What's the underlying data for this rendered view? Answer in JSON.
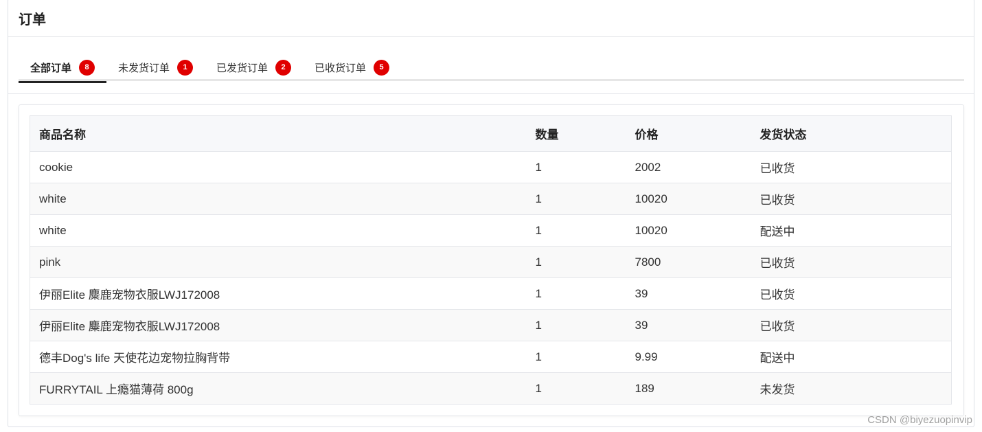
{
  "header": {
    "title": "订单"
  },
  "tabs": [
    {
      "label": "全部订单",
      "count": "8",
      "active": true
    },
    {
      "label": "未发货订单",
      "count": "1",
      "active": false
    },
    {
      "label": "已发货订单",
      "count": "2",
      "active": false
    },
    {
      "label": "已收货订单",
      "count": "5",
      "active": false
    }
  ],
  "table": {
    "columns": [
      "商品名称",
      "数量",
      "价格",
      "发货状态"
    ],
    "rows": [
      [
        "cookie",
        "1",
        "2002",
        "已收货"
      ],
      [
        "white",
        "1",
        "10020",
        "已收货"
      ],
      [
        "white",
        "1",
        "10020",
        "配送中"
      ],
      [
        "pink",
        "1",
        "7800",
        "已收货"
      ],
      [
        "伊丽Elite 麋鹿宠物衣服LWJ172008",
        "1",
        "39",
        "已收货"
      ],
      [
        "伊丽Elite 麋鹿宠物衣服LWJ172008",
        "1",
        "39",
        "已收货"
      ],
      [
        "德丰Dog's life 天使花边宠物拉胸背带",
        "1",
        "9.99",
        "配送中"
      ],
      [
        "FURRYTAIL 上瘾猫薄荷 800g",
        "1",
        "189",
        "未发货"
      ]
    ]
  },
  "watermark": "CSDN @biyezuopinvip",
  "colors": {
    "badge": "#e00000",
    "active_tab_underline": "#222222"
  }
}
